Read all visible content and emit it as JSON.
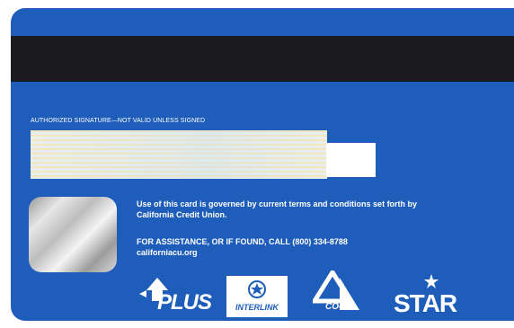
{
  "card": {
    "signature_label": "AUTHORIZED SIGNATURE—NOT VALID UNLESS SIGNED",
    "terms": "Use of this card is governed by current terms and conditions set forth by California Credit Union.",
    "assistance": "FOR ASSISTANCE, OR IF FOUND, CALL (800) 334-8788",
    "website": "californiacu.org"
  },
  "logos": {
    "plus": "PLUS",
    "interlink": "INTERLINK",
    "coop": "CO-OP",
    "star": "STAR"
  },
  "colors": {
    "card_blue": "#1e5db9",
    "mag_stripe": "#1c1c20"
  }
}
